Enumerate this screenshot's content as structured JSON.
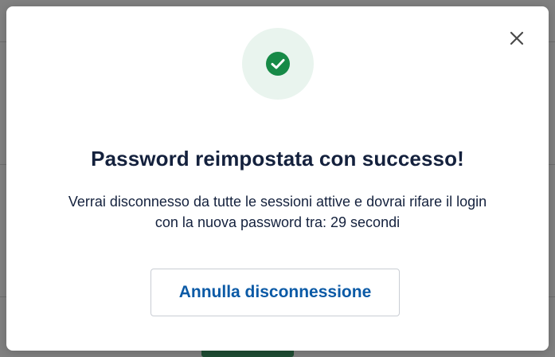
{
  "modal": {
    "title": "Password reimpostata con successo!",
    "message_line1": "Verrai disconnesso da tutte le sessioni attive e dovrai rifare il login",
    "message_line2": "con la nuova password tra: 29 secondi",
    "cancel_button_label": "Annulla disconnessione",
    "close_icon": "close-icon",
    "status_icon": "check-circle-icon"
  },
  "colors": {
    "success_green": "#178a47",
    "success_bg": "#e9f4ee",
    "title_text": "#14213d",
    "link_blue": "#0b5aa6",
    "overlay": "#808080"
  }
}
